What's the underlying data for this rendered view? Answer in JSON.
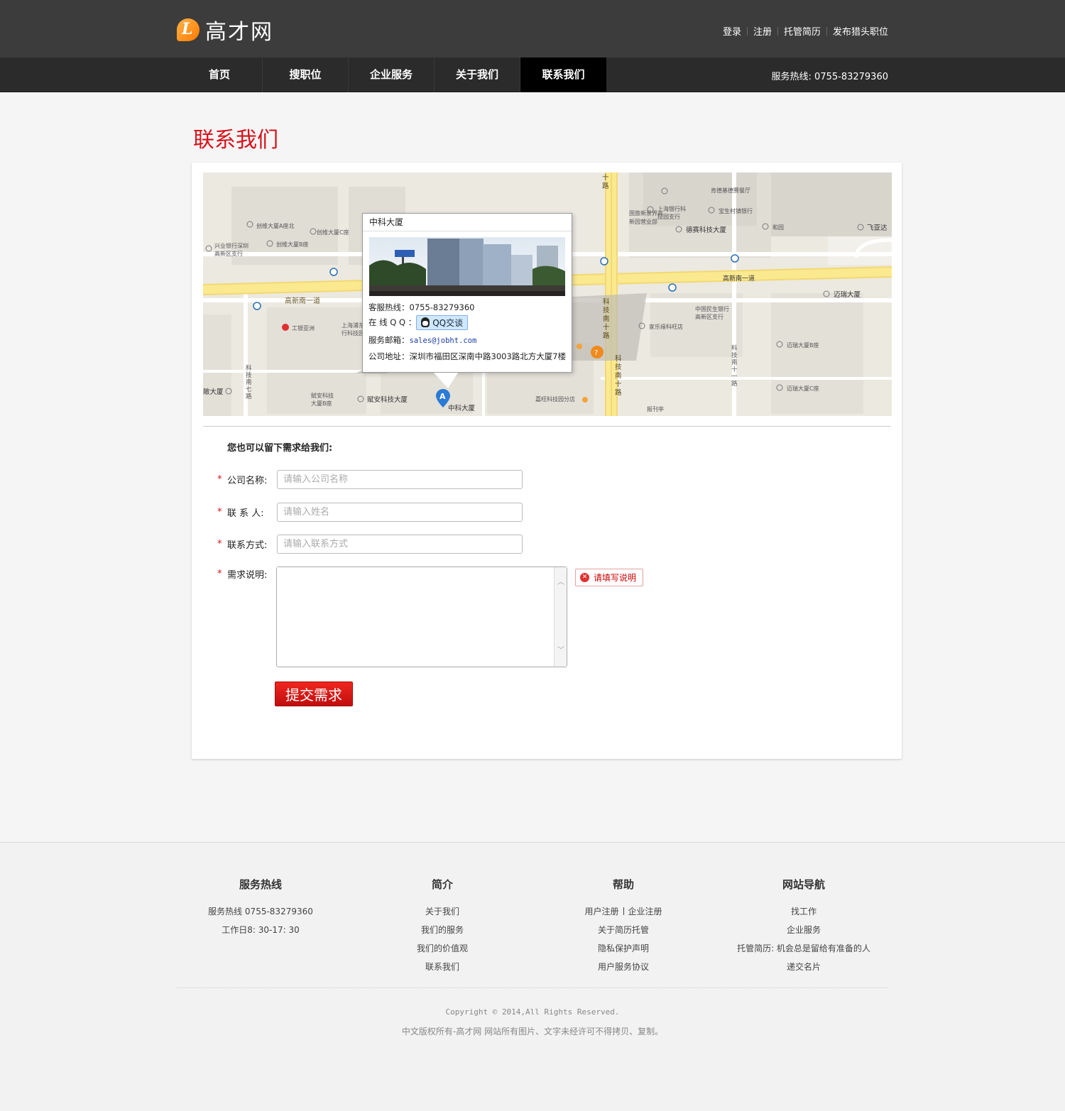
{
  "header": {
    "logo_text": "高才网",
    "links": [
      "登录",
      "注册",
      "托管简历",
      "发布猎头职位"
    ]
  },
  "nav": {
    "items": [
      "首页",
      "搜职位",
      "企业服务",
      "关于我们",
      "联系我们"
    ],
    "active": "联系我们",
    "hotline": "服务热线: 0755-83279360"
  },
  "page": {
    "title": "联系我们"
  },
  "map": {
    "popup": {
      "title": "中科大厦",
      "hotline_label": "客服热线：",
      "hotline_value": "0755-83279360",
      "qq_label": "在 线 Q Q ：",
      "qq_button": "QQ交谈",
      "email_label": "服务邮箱：",
      "email_value": "sales@jobht.com",
      "address_label": "公司地址：",
      "address_value": "深圳市福田区深南中路3003路北方大厦7楼"
    },
    "marker_letter": "A",
    "labels": {
      "kejinan10": "科技南十路",
      "gaoxinnan1_left": "高新南一道",
      "gaoxinnan1_right": "高新南一道",
      "kejinan7": "科技南七路",
      "kejinan11": "科技南十一路",
      "zhongke": "中科大厦",
      "fuan": "赋安科技大厦",
      "fuan_b": "赋安科技\n大厦B座",
      "jiawang": "嘉旺科技园分店",
      "baokanting": "报刊亭",
      "mairui": "迈瑞大厦",
      "mairui_b": "迈瑞大厦B座",
      "mairui_c": "迈瑞大厦C座",
      "desai": "德赛科技大厦",
      "feiyada": "飞亚达",
      "hexiang": "和园",
      "kendeji": "肯德基德赛餐厅",
      "guolv": "国旅新景界高\n新园营业部",
      "shanghai_bank": "上海银行科\n技园支行",
      "baosheng": "宝生村镇银行",
      "minsheng": "中国民生银行\n高新区支行",
      "jiale": "家乐缘科旺店",
      "chuangwei_a": "创维大厦A座北",
      "chuangwei_b": "创维大厦B座",
      "chuangwei_c": "创维大厦C座",
      "xingye": "兴业银行深圳\n高新区支行",
      "gongyin": "工银亚洲",
      "shanghai_pudong": "上海浦东\n行科技园",
      "shangfu": "敞大厦",
      "road_ten": "十路"
    }
  },
  "form": {
    "heading": "您也可以留下需求给我们:",
    "fields": [
      {
        "label": "公司名称:",
        "placeholder": "请输入公司名称",
        "value": ""
      },
      {
        "label": "联 系 人:",
        "placeholder": "请输入姓名",
        "value": ""
      },
      {
        "label": "联系方式:",
        "placeholder": "请输入联系方式",
        "value": ""
      }
    ],
    "textarea_label": "需求说明:",
    "textarea_value": "",
    "error": "请填写说明",
    "submit": "提交需求",
    "required_mark": "*"
  },
  "footer": {
    "cols": [
      {
        "title": "服务热线",
        "lines": [
          "服务热线 0755-83279360",
          "工作日8: 30-17: 30"
        ]
      },
      {
        "title": "简介",
        "lines": [
          "关于我们",
          "我们的服务",
          "我们的价值观",
          "联系我们"
        ]
      },
      {
        "title": "帮助",
        "line1_a": "用户注册",
        "line1_b": "企业注册",
        "lines": [
          "关于简历托管",
          "隐私保护声明",
          "用户服务协议"
        ]
      },
      {
        "title": "网站导航",
        "lines": [
          "找工作",
          "企业服务",
          "托管简历: 机会总是留给有准备的人",
          "递交名片"
        ]
      }
    ],
    "copyright": "Copyright © 2014,All Rights Reserved.",
    "notice": "中文版权所有-高才网 网站所有图片、文字未经许可不得拷贝、复制。"
  },
  "colors": {
    "accent_red": "#d8121b",
    "header_bg": "#3c3c3c",
    "nav_bg": "#2b2b2b"
  }
}
